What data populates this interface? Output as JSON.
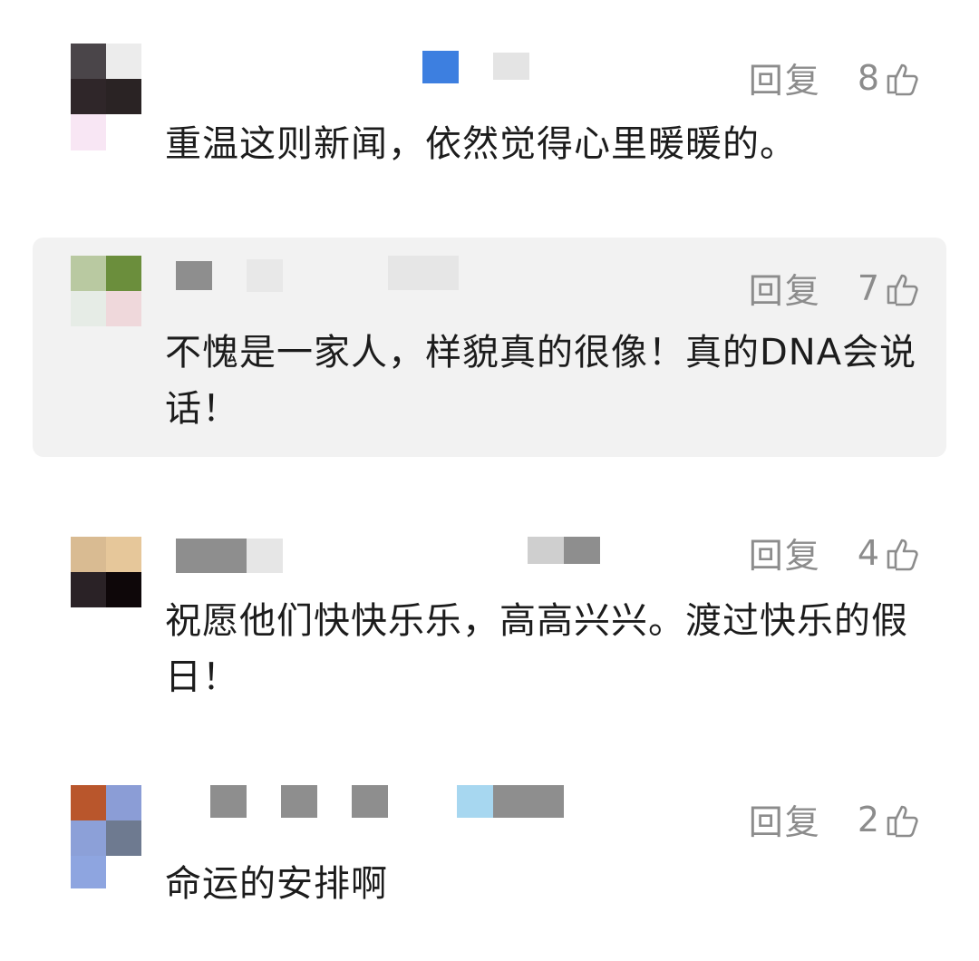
{
  "comments": [
    {
      "reply_label": "回复",
      "likes": "8",
      "text": "重温这则新闻，依然觉得心里暖暖的。",
      "highlighted": false,
      "avatar_colors": [
        "#4a4549",
        "#ececec",
        "#2f2629",
        "#2a2324",
        "#f8e6f4",
        "#ffffff"
      ]
    },
    {
      "reply_label": "回复",
      "likes": "7",
      "text": "不愧是一家人，样貌真的很像！真的DNA会说话！",
      "highlighted": true,
      "avatar_colors": [
        "#b9c9a1",
        "#6b8e3c",
        "#e6ece6",
        "#efd8db"
      ]
    },
    {
      "reply_label": "回复",
      "likes": "4",
      "text": "祝愿他们快快乐乐，高高兴兴。渡过快乐的假日！",
      "highlighted": false,
      "avatar_colors": [
        "#d9bb92",
        "#e6c79a",
        "#2a2226",
        "#0e0709"
      ]
    },
    {
      "reply_label": "回复",
      "likes": "2",
      "text": "命运的安排啊",
      "highlighted": false,
      "avatar_colors": [
        "#b9562c",
        "#8b9dd6",
        "#8ca0d8",
        "#6e7a90",
        "#8ea5e0",
        "#ffffff"
      ]
    }
  ],
  "icons": {
    "like": "thumbs-up-icon"
  },
  "colors": {
    "accent_blue": "#3d7fe0",
    "meta_gray": "#8c8c8c",
    "highlight_bg": "#f2f2f2"
  }
}
